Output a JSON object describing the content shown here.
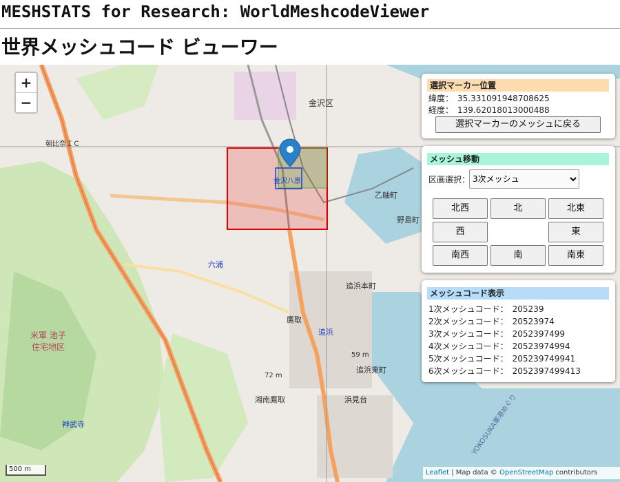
{
  "header": {
    "site_title": "MESHSTATS for Research: WorldMeshcodeViewer",
    "page_title": "世界メッシュコード ビューワー"
  },
  "zoom": {
    "in_label": "+",
    "out_label": "−"
  },
  "marker_panel": {
    "title": "選択マーカー位置",
    "lat_label": "緯度：",
    "lat_value": "35.331091948708625",
    "lng_label": "経度：",
    "lng_value": "139.62018013000488",
    "return_button": "選択マーカーのメッシュに戻る"
  },
  "move_panel": {
    "title": "メッシュ移動",
    "level_label": "区画選択：",
    "level_selected": "3次メッシュ",
    "nw": "北西",
    "n": "北",
    "ne": "北東",
    "w": "西",
    "e": "東",
    "sw": "南西",
    "s": "南",
    "se": "南東"
  },
  "code_panel": {
    "title": "メッシュコード表示",
    "rows": [
      {
        "label": "1次メッシュコード：",
        "value": "205239"
      },
      {
        "label": "2次メッシュコード：",
        "value": "20523974"
      },
      {
        "label": "3次メッシュコード：",
        "value": "2052397499"
      },
      {
        "label": "4次メッシュコード：",
        "value": "20523974994"
      },
      {
        "label": "5次メッシュコード：",
        "value": "205239749941"
      },
      {
        "label": "6次メッシュコード：",
        "value": "2052397499413"
      }
    ]
  },
  "map_labels": {
    "kanazawa_ku": "金沢区",
    "kanazawa_hakkei": "金沢八景",
    "rokuura": "六浦",
    "oppama": "追浜",
    "oppama_honcho": "追浜本町",
    "oppama_higashi": "追浜東町",
    "takatori": "鷹取",
    "shonan_takatori": "湘南鷹取",
    "hamami": "浜見台",
    "jinmuji": "神武寺",
    "nojima": "野島町",
    "hairi": "乙舳町",
    "asahina": "朝比奈ＩＣ",
    "beigun": "米軍 池子住宅地区",
    "elevation_1": "72 m",
    "elevation_2": "59 m",
    "yokosuka": "YOKOSUKA軍港めぐり"
  },
  "scale": {
    "label": "500 m"
  },
  "attribution": {
    "leaflet": "Leaflet",
    "sep": "| Map data ©",
    "osm": "OpenStreetMap",
    "contrib": "contributors"
  },
  "colors": {
    "marker_header": "#fddcb0",
    "move_header": "#a8f5d9",
    "code_header": "#b6dcfa",
    "mesh_red": "#e00000",
    "water": "#aad3df"
  }
}
